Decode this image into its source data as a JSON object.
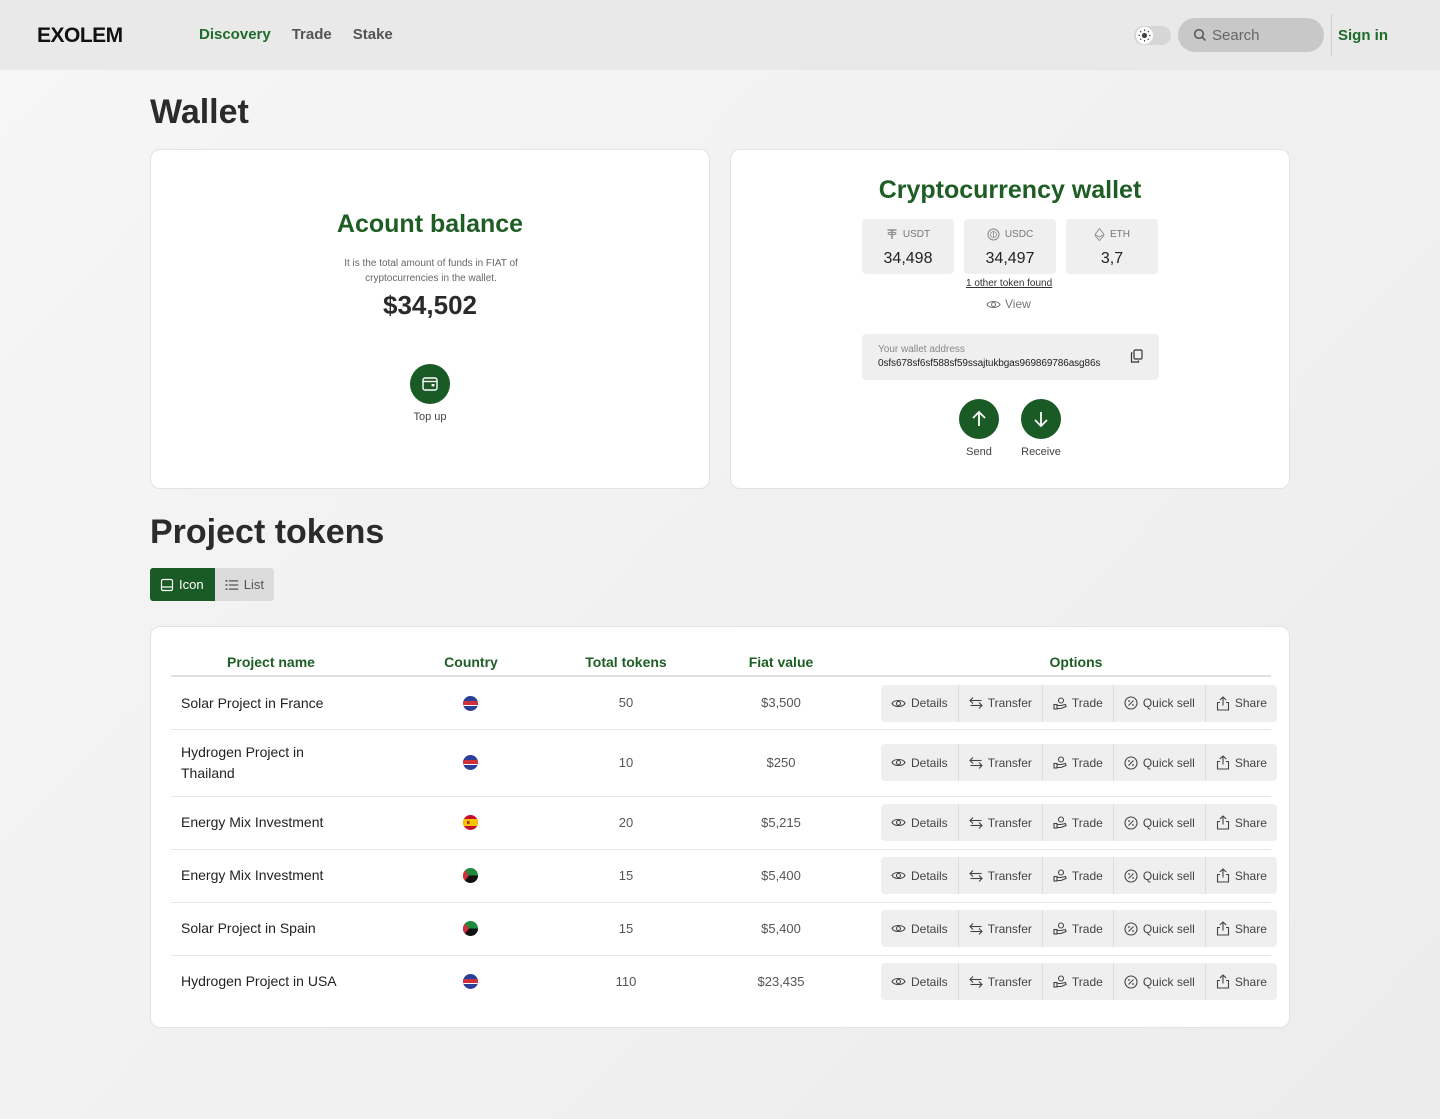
{
  "header": {
    "logo": "EXOLEM",
    "nav": [
      {
        "label": "Discovery",
        "active": true
      },
      {
        "label": "Trade",
        "active": false
      },
      {
        "label": "Stake",
        "active": false
      }
    ],
    "theme_icon": "sun-icon",
    "search_placeholder": "Search",
    "signin": "Sign in"
  },
  "page_title": "Wallet",
  "balance": {
    "title": "Acount balance",
    "description": "It is the total amount of funds in FIAT of cryptocurrencies in the wallet.",
    "amount": "$34,502",
    "topup_label": "Top up"
  },
  "crypto": {
    "title": "Cryptocurrency wallet",
    "tokens": [
      {
        "name": "USDT",
        "value": "34,498",
        "icon": "tether-icon"
      },
      {
        "name": "USDC",
        "value": "34,497",
        "icon": "usdc-icon"
      },
      {
        "name": "ETH",
        "value": "3,7",
        "icon": "ethereum-icon"
      }
    ],
    "other_token": "1 other token found",
    "view_label": "View",
    "address_label": "Your wallet address",
    "address": "0sfs678sf6sf588sf59ssajtukbgas969869786asg86s",
    "send_label": "Send",
    "receive_label": "Receive"
  },
  "section_title": "Project tokens",
  "view_toggle": {
    "icon_label": "Icon",
    "list_label": "List"
  },
  "table": {
    "headers": {
      "name": "Project name",
      "country": "Country",
      "tokens": "Total tokens",
      "fiat": "Fiat value",
      "options": "Options"
    },
    "option_labels": {
      "details": "Details",
      "transfer": "Transfer",
      "trade": "Trade",
      "quick_sell": "Quick sell",
      "share": "Share"
    },
    "rows": [
      {
        "name": "Solar Project in France",
        "flag": "flag-blue-red",
        "tokens": "50",
        "fiat": "$3,500"
      },
      {
        "name": "Hydrogen Project in Thailand",
        "flag": "flag-blue-red",
        "tokens": "10",
        "fiat": "$250"
      },
      {
        "name": "Energy Mix Investment",
        "flag": "flag-spain",
        "tokens": "20",
        "fiat": "$5,215"
      },
      {
        "name": "Energy Mix Investment",
        "flag": "flag-green-red-black",
        "tokens": "15",
        "fiat": "$5,400"
      },
      {
        "name": "Solar Project in Spain",
        "flag": "flag-green-red-black",
        "tokens": "15",
        "fiat": "$5,400"
      },
      {
        "name": "Hydrogen Project in USA",
        "flag": "flag-blue-red",
        "tokens": "110",
        "fiat": "$23,435"
      }
    ]
  },
  "colors": {
    "brand_green": "#1a5a24",
    "heading_green": "#1e5e25"
  }
}
